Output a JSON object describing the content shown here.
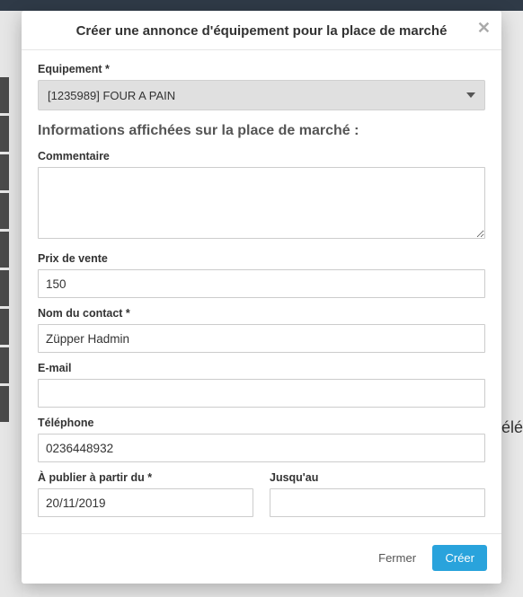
{
  "bg": {
    "right_text": "élé"
  },
  "modal": {
    "title": "Créer une annonce d'équipement pour la place de marché",
    "equipment": {
      "label": "Equipement *",
      "selected": "[1235989] FOUR A PAIN"
    },
    "section_heading": "Informations affichées sur la place de marché :",
    "comment": {
      "label": "Commentaire",
      "value": ""
    },
    "price": {
      "label": "Prix de vente",
      "value": "150"
    },
    "contact_name": {
      "label": "Nom du contact *",
      "value": "Züpper Hadmin"
    },
    "email": {
      "label": "E-mail",
      "value": ""
    },
    "phone": {
      "label": "Téléphone",
      "value": "0236448932"
    },
    "publish_from": {
      "label": "À publier à partir du *",
      "value": "20/11/2019"
    },
    "publish_until": {
      "label": "Jusqu'au",
      "value": ""
    },
    "footer": {
      "close": "Fermer",
      "create": "Créer"
    }
  }
}
